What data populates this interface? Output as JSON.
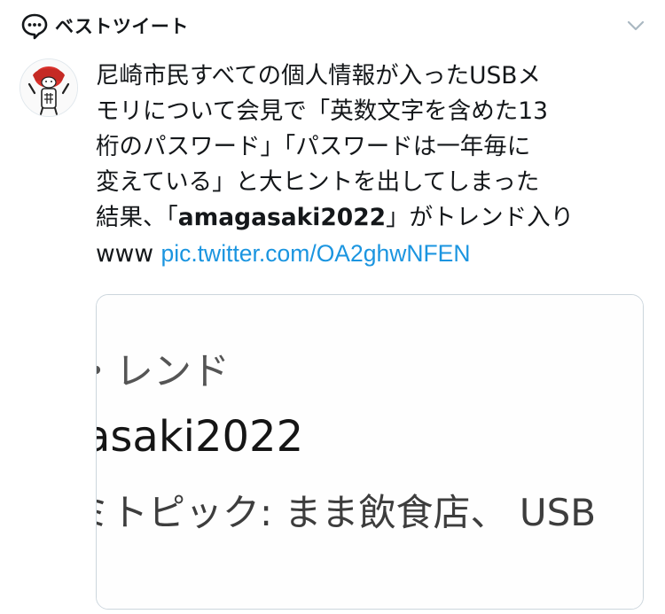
{
  "header": {
    "label": "ベストツイート",
    "icon": "speech-bubble-icon",
    "menu_icon": "chevron-down-icon"
  },
  "tweet": {
    "avatar_icon": "avatar",
    "text_lines": [
      "尼崎市民すべての個人情報が入ったUSBメ",
      "モリについて会見で「英数文字を含めた13",
      "桁のパスワード」「パスワードは一年毎に",
      "変えている」と大ヒントを出してしまった"
    ],
    "line5_prefix": "結果、「",
    "line5_bold": "amagasaki2022",
    "line5_suffix": "」がトレンド入り",
    "line6_prefix": "www ",
    "link": "pic.twitter.com/OA2ghwNFEN"
  },
  "card": {
    "line1": "・レンド",
    "line2": "asaki2022",
    "line3": "ミトピック: まま飲食店、 USB"
  },
  "colors": {
    "text": "#14171a",
    "link": "#1b95e0",
    "border": "#ccd6dd",
    "icon_gray": "#657786"
  }
}
